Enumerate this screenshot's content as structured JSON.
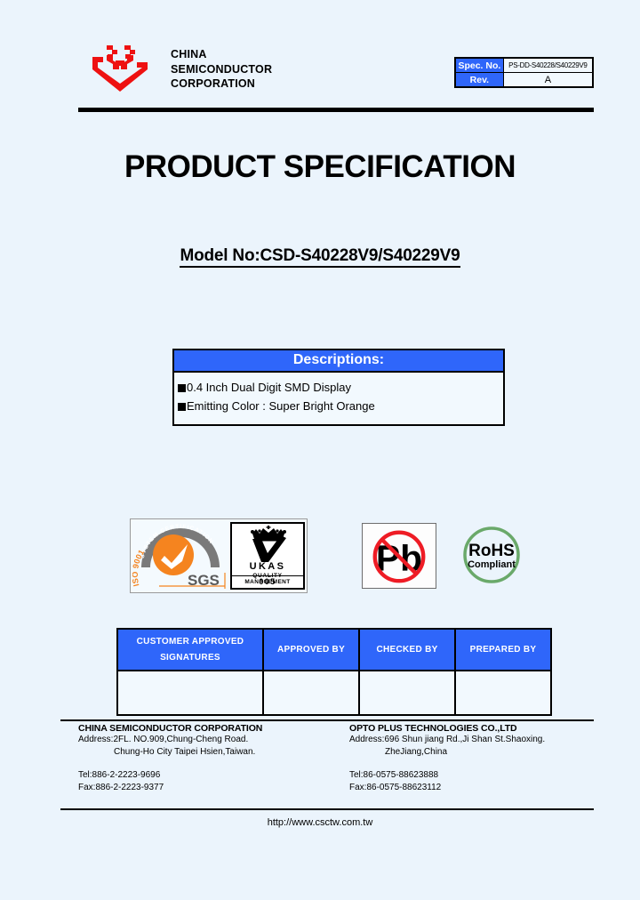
{
  "header": {
    "logo_icon": "csc-red-emblem-logo",
    "company_name_lines": [
      "CHINA",
      "SEMICONDUCTOR",
      "CORPORATION"
    ],
    "spec_table": {
      "spec_no_label": "Spec. No.",
      "spec_no_value": "PS-DD-S40228/S40229V9",
      "rev_label": "Rev.",
      "rev_value": "A"
    }
  },
  "titles": {
    "document_title": "PRODUCT SPECIFICATION",
    "model_no": "Model No:CSD-S40228V9/S40229V9"
  },
  "descriptions": {
    "heading": "Descriptions:",
    "items": [
      "0.4 Inch Dual Digit  SMD Display",
      "Emitting Color : Super Bright Orange"
    ]
  },
  "certifications": {
    "sgs": {
      "arc_text": "SYSTEM CERTIFICATION",
      "standard": "ISO 9001:2000",
      "brand": "SGS",
      "icon": "sgs-orange-check-icon"
    },
    "ukas": {
      "name": "UKAS",
      "sub_line1": "QUALITY",
      "sub_line2": "MANAGEMENT",
      "number": "005",
      "icon": "ukas-crown-tick-icon"
    },
    "lead_free": {
      "symbol": "Pb",
      "icon": "pb-prohibited-icon"
    },
    "rohs": {
      "line1": "RoHS",
      "line2": "Compliant",
      "icon": "rohs-compliant-icon"
    }
  },
  "signature_table": {
    "headers": [
      {
        "line1": "CUSTOMER APPROVED",
        "line2": "SIGNATURES"
      },
      {
        "line1": "APPROVED BY",
        "line2": ""
      },
      {
        "line1": "CHECKED BY",
        "line2": ""
      },
      {
        "line1": "PREPARED BY",
        "line2": ""
      }
    ],
    "values": [
      "",
      "",
      "",
      ""
    ]
  },
  "footer": {
    "left": {
      "company": "CHINA SEMICONDUCTOR CORPORATION",
      "address_line1": "Address:2FL. NO.909,Chung-Cheng Road.",
      "address_line2": "Chung-Ho City Taipei Hsien,Taiwan.",
      "tel": "Tel:886-2-2223-9696",
      "fax": "Fax:886-2-2223-9377"
    },
    "right": {
      "company": "OPTO PLUS TECHNOLOGIES CO.,LTD",
      "address_line1": "Address:696 Shun jiang Rd.,Ji Shan St.Shaoxing.",
      "address_line2": "ZheJiang,China",
      "tel": "Tel:86-0575-88623888",
      "fax": "Fax:86-0575-88623112"
    },
    "website": "http://www.csctw.com.tw"
  },
  "colors": {
    "page_background": "#ebf4fc",
    "accent_blue": "#2f66fa",
    "logo_red": "#ee1111",
    "sgs_orange": "#f5841f",
    "rohs_green": "#6aa96a",
    "pb_red": "#ee1c25"
  }
}
